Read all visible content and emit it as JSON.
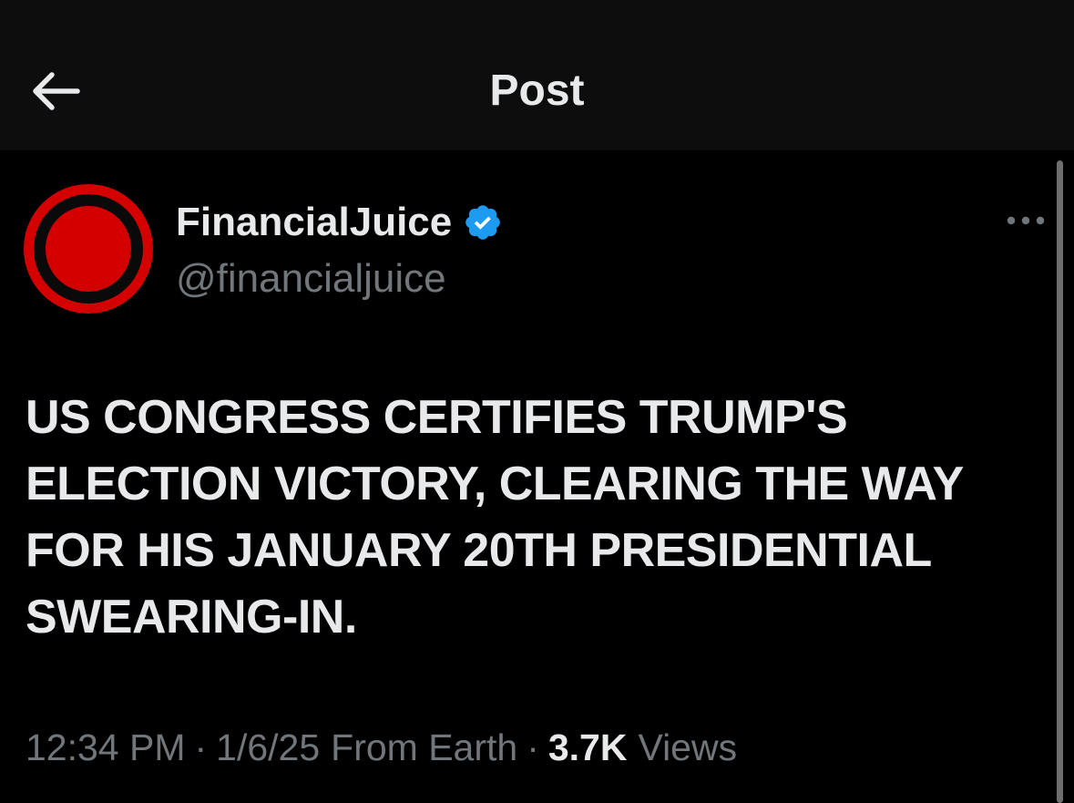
{
  "header": {
    "title": "Post"
  },
  "icons": {
    "back": "arrow-left-icon",
    "verified": "verified-badge-icon",
    "more": "ellipsis-icon"
  },
  "colors": {
    "background": "#000000",
    "header_background": "#0d0d0d",
    "primary_text": "#e7e9ea",
    "secondary_text": "#71767b",
    "verified_blue": "#1d9bf0",
    "avatar_red": "#d40000"
  },
  "author": {
    "display_name": "FinancialJuice",
    "handle": "@financialjuice",
    "verified": true
  },
  "post": {
    "text": "US CONGRESS CERTIFIES TRUMP'S ELECTION VICTORY, CLEARING THE WAY FOR HIS JANUARY 20TH PRESIDENTIAL SWEARING-IN."
  },
  "meta": {
    "time": "12:34 PM",
    "date": "1/6/25",
    "location": "From Earth",
    "separator": "·",
    "views_count": "3.7K",
    "views_label": "Views"
  }
}
